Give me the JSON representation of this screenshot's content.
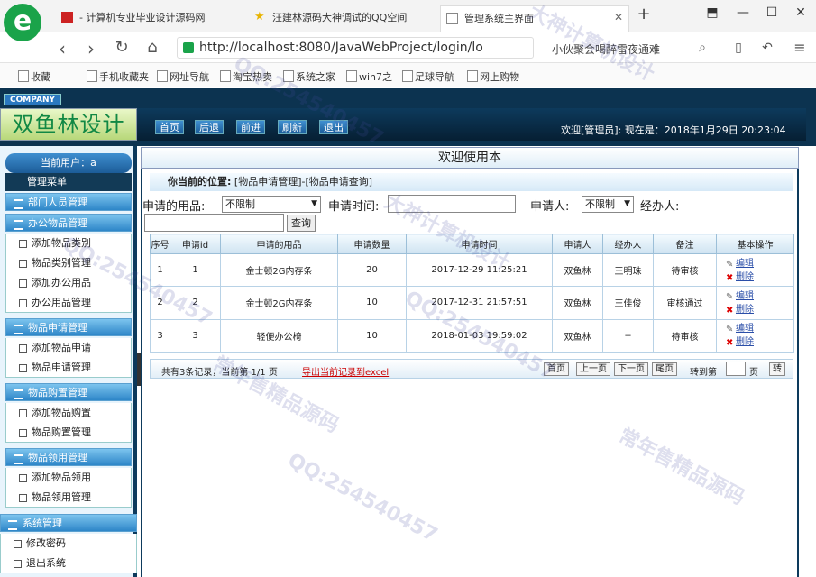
{
  "browser": {
    "tabs": [
      {
        "label": "- 计算机专业毕业设计源码网"
      },
      {
        "label": "汪建林源码大神调试的QQ空间"
      },
      {
        "label": "管理系统主界面"
      }
    ],
    "new_tab": "+",
    "url": "http://localhost:8080/JavaWebProject/login/lo",
    "search_text": "小伙聚会喝醉雷夜通难",
    "bookmarks": [
      "收藏",
      "手机收藏夹",
      "网址导航",
      "淘宝热卖",
      "系统之家",
      "win7之",
      "足球导航",
      "网上购物"
    ]
  },
  "app": {
    "company": "COMPANY",
    "brand": "双鱼林设计",
    "nav": [
      "首页",
      "后退",
      "前进",
      "刷新",
      "退出"
    ],
    "welcome": "欢迎[管理员]:   现在是：2018年1月29日 20:23:04"
  },
  "sidebar": {
    "current_user": "当前用户：a",
    "menu_title": "管理菜单",
    "sections": [
      {
        "title": "部门人员管理",
        "items": []
      },
      {
        "title": "办公物品管理",
        "items": [
          "添加物品类别",
          "物品类别管理",
          "添加办公用品",
          "办公用品管理"
        ]
      },
      {
        "title": "物品申请管理",
        "items": [
          "添加物品申请",
          "物品申请管理"
        ]
      },
      {
        "title": "物品购置管理",
        "items": [
          "添加物品购置",
          "物品购置管理"
        ]
      },
      {
        "title": "物品领用管理",
        "items": [
          "添加物品领用",
          "物品领用管理"
        ]
      },
      {
        "title": "系统管理",
        "items": [
          "修改密码",
          "退出系统"
        ]
      }
    ]
  },
  "main": {
    "title": "欢迎使用本",
    "location_label": "你当前的位置:",
    "location_path": "[物品申请管理]-[物品申请查询]",
    "filters": {
      "item_label": "申请的用品:",
      "item_value": "不限制",
      "time_label": "申请时间:",
      "time_value": "",
      "applicant_label": "申请人:",
      "applicant_value": "不限制",
      "handler_label": "经办人:",
      "handler_value": "",
      "query_button": "查询"
    },
    "table": {
      "headers": [
        "序号",
        "申请id",
        "申请的用品",
        "申请数量",
        "申请时间",
        "申请人",
        "经办人",
        "备注",
        "基本操作"
      ],
      "rows": [
        [
          "1",
          "1",
          "金士顿2G内存条",
          "20",
          "2017-12-29 11:25:21",
          "双鱼林",
          "王明珠",
          "待审核"
        ],
        [
          "2",
          "2",
          "金士顿2G内存条",
          "10",
          "2017-12-31 21:57:51",
          "双鱼林",
          "王佳俊",
          "审核通过"
        ],
        [
          "3",
          "3",
          "轻便办公椅",
          "10",
          "2018-01-03 19:59:02",
          "双鱼林",
          "--",
          "待审核"
        ]
      ],
      "edit_label": "编辑",
      "delete_label": "删除"
    },
    "pager": {
      "summary": "共有3条记录，当前第 1/1 页",
      "export": "导出当前记录到excel",
      "first": "首页",
      "prev": "上一页",
      "next": "下一页",
      "last": "尾页",
      "goto": "转到第",
      "page": "页",
      "go": "转"
    }
  },
  "watermarks": [
    "大神计算机设计",
    "QQ:254540457",
    "常年售精品源码"
  ],
  "colors": {
    "header": "#0c3350",
    "accent": "#2e86c8",
    "brand_green": "#1aa34a",
    "export_red": "#cc0000"
  }
}
